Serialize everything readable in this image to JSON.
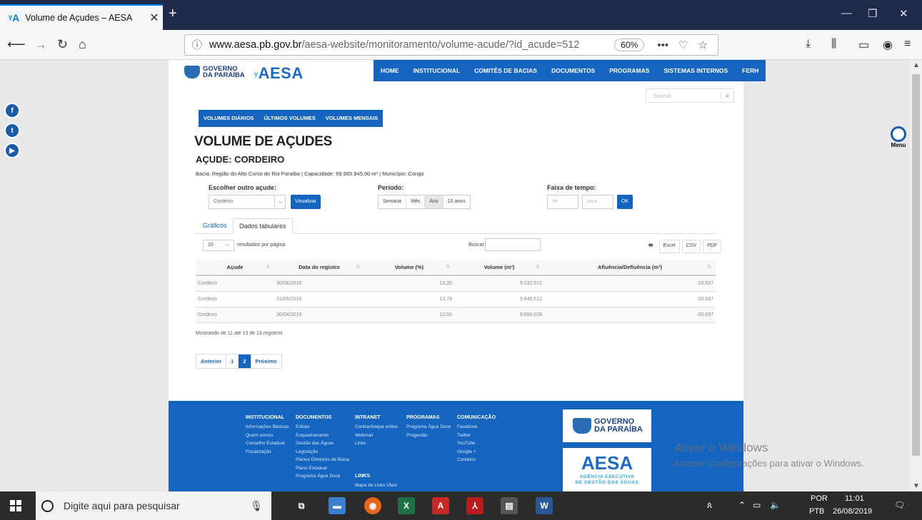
{
  "browser": {
    "tab_title": "Volume de Açudes – AESA",
    "url_domain": "www.aesa.pb.gov.br",
    "url_path": "/aesa-website/monitoramento/volume-acude/?id_acude=512",
    "zoom": "60%"
  },
  "site": {
    "logo_gov_line1": "GOVERNO",
    "logo_gov_line2": "DA PARAÍBA",
    "logo_aesa": "AESA",
    "nav": [
      "HOME",
      "INSTITUCIONAL",
      "COMITÊS DE BACIAS",
      "DOCUMENTOS",
      "PROGRAMAS",
      "SISTEMAS INTERNOS",
      "FERH"
    ],
    "search_placeholder": "Buscar",
    "subnav": [
      "VOLUMES DIÁRIOS",
      "ÚLTIMOS VOLUMES",
      "VOLUMES MENSAIS"
    ],
    "menu_label": "Menu",
    "social": [
      "f",
      "t",
      "▶"
    ]
  },
  "content": {
    "title": "VOLUME DE AÇUDES",
    "subtitle": "AÇUDE: CORDEIRO",
    "meta": "Bacia: Região do Alto Curso do Rio Paraíba | Capacidade: 69.965.945,00 m³ | Município: Congo",
    "choose_label": "Escolher outro açude:",
    "choose_value": "Cordeiro",
    "visualizar": "Visualizar",
    "periodo_label": "Período:",
    "periodo_options": [
      "Semana",
      "Mês",
      "Ano",
      "10 anos"
    ],
    "periodo_selected": "Ano",
    "faixa_label": "Faixa de tempo:",
    "de_placeholder": "de",
    "para_placeholder": "para",
    "ok": "OK",
    "tabs": [
      "Gráficos",
      "Dados tabulares"
    ],
    "active_tab": "Dados tabulares"
  },
  "table_controls": {
    "page_length": "10",
    "page_length_label": "resultados por página",
    "search_label": "Buscar:",
    "export": [
      "Excel",
      "CSV",
      "PDF"
    ]
  },
  "table": {
    "columns": [
      "Açude",
      "Data do registro",
      "Volume (%)",
      "Volume (m³)",
      "Afluência/Defluência (m³)"
    ],
    "rows": [
      [
        "Cordeiro",
        "30/06/2019",
        "13,20",
        "9.232.572",
        "-20.697"
      ],
      [
        "Cordeiro",
        "31/05/2019",
        "13,79",
        "9.646.512",
        "-20.697"
      ],
      [
        "Cordeiro",
        "30/04/2019",
        "12,66",
        "8.860.028",
        "-20.697"
      ]
    ],
    "info": "Mostrando de 11 até 13 de 13 registros",
    "pager": [
      "Anterior",
      "1",
      "2",
      "Próximo"
    ],
    "current_page": "2"
  },
  "footer": {
    "columns": [
      {
        "head": "INSTITUCIONAL",
        "links": [
          "Informações Básicas",
          "Quem somos",
          "Conselho Estadual",
          "Fiscalização"
        ]
      },
      {
        "head": "DOCUMENTOS",
        "links": [
          "Editais",
          "Enquadramento",
          "Gestão das Águas",
          "Legislação",
          "Planos Diretores de Bacia",
          "Plano Estadual",
          "Programa Água Doce"
        ]
      },
      {
        "head": "INTRANET",
        "links": [
          "Contracheque online",
          "Webmail",
          "Links"
        ],
        "head2": "LINKS",
        "links2": [
          "Mapa de Links Úteis"
        ]
      },
      {
        "head": "PROGRAMAS",
        "links": [
          "Programa Água Doce",
          "Progestão"
        ]
      },
      {
        "head": "COMUNICAÇÃO",
        "links": [
          "Facebook",
          "Twitter",
          "YouTube",
          "Google +",
          "Contatos"
        ]
      }
    ],
    "gov_line1": "GOVERNO",
    "gov_line2": "DA PARAÍBA",
    "aesa": "AESA",
    "aesa_sub1": "AGÊNCIA EXECUTIVA",
    "aesa_sub2": "DE GESTÃO DAS ÁGUAS"
  },
  "watermark": {
    "line1": "Ativar o Windows",
    "line2": "Acesse Configurações para ativar o Windows."
  },
  "taskbar": {
    "search_placeholder": "Digite aqui para pesquisar",
    "lang1": "POR",
    "lang2": "PTB",
    "time": "11:01",
    "date": "26/08/2019"
  }
}
